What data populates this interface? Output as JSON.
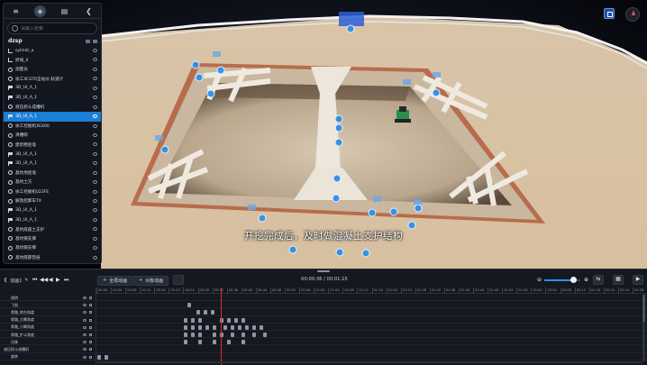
{
  "panel": {
    "tabs": [
      {
        "icon": "layers-icon",
        "label": "≡"
      },
      {
        "icon": "stack-icon",
        "label": "◈"
      },
      {
        "icon": "archive-icon",
        "label": "▤"
      },
      {
        "icon": "collapse-icon",
        "label": "❮"
      }
    ],
    "search_placeholder": "请输入检索",
    "project_name": "dzsp",
    "items": [
      {
        "type": "path",
        "label": "sylindr_a"
      },
      {
        "type": "path",
        "label": "折线_II"
      },
      {
        "type": "model",
        "label": "测量员"
      },
      {
        "type": "model",
        "label": "徐工XCS70全站仪-轨道计"
      },
      {
        "type": "flag",
        "label": "3D_UI_A_1"
      },
      {
        "type": "flag",
        "label": "3D_UI_A_1"
      },
      {
        "type": "model",
        "label": "液压抓斗成槽机"
      },
      {
        "type": "flag",
        "label": "3D_UI_A_1",
        "selected": true
      },
      {
        "type": "model",
        "label": "徐工挖掘机XE400"
      },
      {
        "type": "model",
        "label": "清槽筒"
      },
      {
        "type": "model",
        "label": "建筑物连墙"
      },
      {
        "type": "flag",
        "label": "3D_UI_A_1"
      },
      {
        "type": "flag",
        "label": "3D_UI_A_1"
      },
      {
        "type": "model",
        "label": "基坑地连墙"
      },
      {
        "type": "model",
        "label": "基坑土方"
      },
      {
        "type": "model",
        "label": "徐工挖掘机022FE"
      },
      {
        "type": "model",
        "label": "解放后卸车TX"
      },
      {
        "type": "flag",
        "label": "3D_UI_A_1"
      },
      {
        "type": "flag",
        "label": "3D_UI_A_1"
      },
      {
        "type": "model",
        "label": "基坑底座土支护"
      },
      {
        "type": "model",
        "label": "基坑钢支撑"
      },
      {
        "type": "model",
        "label": "基坑钢支撑"
      },
      {
        "type": "model",
        "label": "基坑底部垫层"
      }
    ]
  },
  "caption": "开挖完成后，及时做混凝土支护结构",
  "timeline": {
    "animation_label": "动画1",
    "play_controls": [
      "⏮",
      "◀◀",
      "◀",
      "▶",
      "⏭"
    ],
    "btn_global": "全局动画",
    "btn_object": "对象动画",
    "timecode": "00:00:36 / 00:01:15",
    "zoom_fraction": 0.82,
    "right_buttons": [
      "⇆",
      "▦",
      "▶"
    ],
    "ticks": [
      "00:00",
      "00:04",
      "00:08",
      "00:12",
      "00:16",
      "00:20",
      "00:24",
      "00:28",
      "00:32",
      "00:36",
      "00:40",
      "00:44",
      "00:48",
      "00:52",
      "00:56",
      "01:00",
      "01:04",
      "01:08",
      "01:12",
      "01:16",
      "01:20",
      "01:24",
      "01:28",
      "01:32",
      "01:36",
      "01:40",
      "01:44",
      "01:48",
      "01:52",
      "01:56",
      "02:00",
      "02:04",
      "02:08",
      "02:12",
      "02:16",
      "02:20",
      "02:24",
      "02:28"
    ],
    "tracks": [
      {
        "label": "透明",
        "group": false
      },
      {
        "label": "飞到",
        "group": false
      },
      {
        "label": "骨骼_转台角度",
        "group": false
      },
      {
        "label": "骨骼_大臂角度",
        "group": false
      },
      {
        "label": "骨骼_小臂角度",
        "group": false
      },
      {
        "label": "骨骼_铲斗角度",
        "group": false
      },
      {
        "label": "位移",
        "group": false
      },
      {
        "label": "液压抓斗成槽机",
        "group": true
      },
      {
        "label": "旋转",
        "group": false
      }
    ]
  }
}
